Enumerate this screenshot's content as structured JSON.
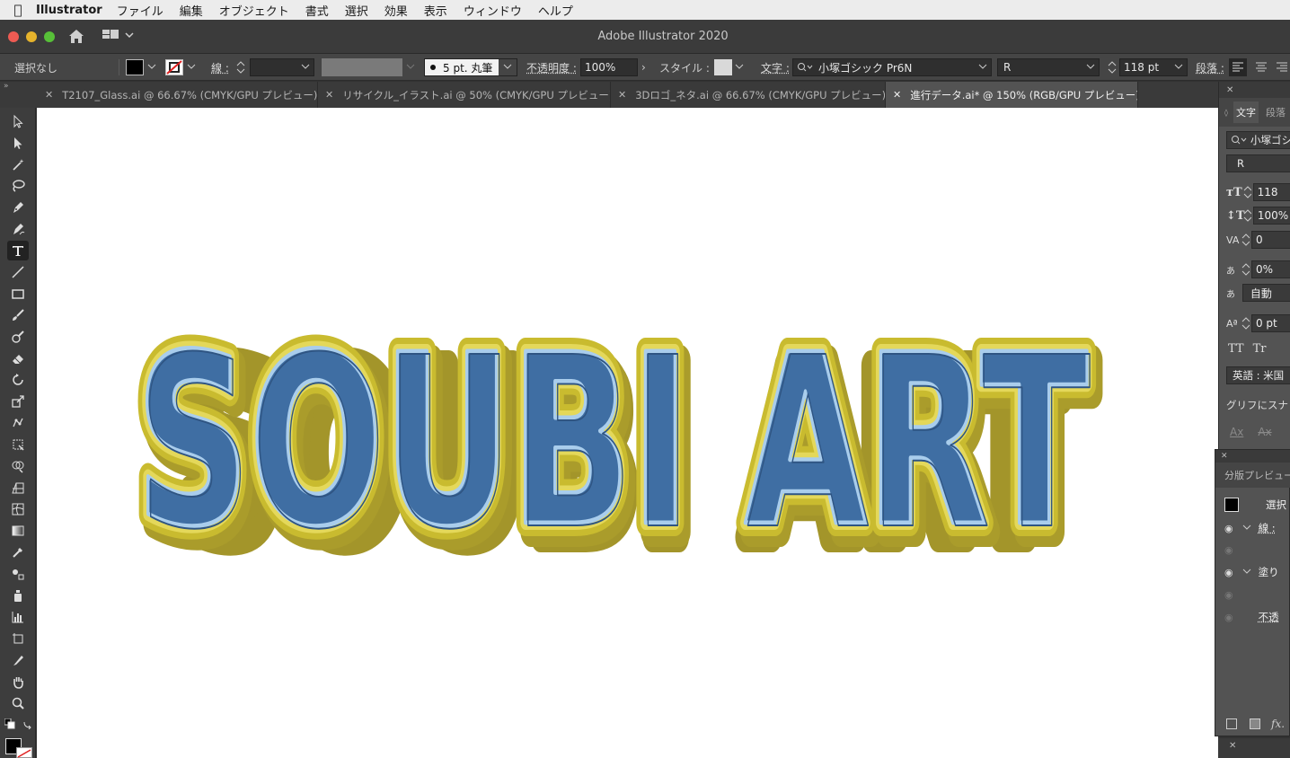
{
  "menubar": {
    "app_name": "Illustrator",
    "items": [
      "ファイル",
      "編集",
      "オブジェクト",
      "書式",
      "選択",
      "効果",
      "表示",
      "ウィンドウ",
      "ヘルプ"
    ]
  },
  "window": {
    "title": "Adobe Illustrator 2020"
  },
  "control_bar": {
    "selection_label": "選択なし",
    "stroke_label": "線 :",
    "brush_value": "5 pt. 丸筆",
    "opacity_label": "不透明度 :",
    "opacity_value": "100%",
    "style_label": "スタイル :",
    "char_label": "文字 :",
    "font_family": "小塚ゴシック Pr6N",
    "font_style": "R",
    "font_size": "118 pt",
    "paragraph_label": "段落 :"
  },
  "tabs": [
    {
      "label": "T2107_Glass.ai @ 66.67% (CMYK/GPU プレビュー)"
    },
    {
      "label": "リサイクル_イラスト.ai @ 50% (CMYK/GPU プレビュー)"
    },
    {
      "label": "3Dロゴ_ネタ.ai @ 66.67% (CMYK/GPU プレビュー)"
    },
    {
      "label": "進行データ.ai* @ 150% (RGB/GPU プレビュー)"
    }
  ],
  "canvas": {
    "artwork_text": "SOUBI ART"
  },
  "character_panel": {
    "tab_char": "文字",
    "tab_para": "段落",
    "font_family": "小塚ゴシ",
    "font_style": "R",
    "size": "118",
    "leading": "100%",
    "kerning": "0",
    "tsume": "0%",
    "aki": "自動",
    "baseline": "0 pt",
    "tt1": "TT",
    "tt2": "Tr",
    "language": "英語 : 米国",
    "snap": "グリフにスナ",
    "ax1": "Ax",
    "ax2": "Ax"
  },
  "separations_panel": {
    "title": "分版プレビュー",
    "row1": "選択",
    "row2": "線 :",
    "row3": "塗り",
    "row4": "不透",
    "fx": "fx."
  },
  "colors": {
    "text_blue": "#3f6ea3",
    "text_blue_highlight": "#a9cdec",
    "bevel_yellow": "#c9bb2f",
    "extrude_yellow": "#a3952a"
  }
}
